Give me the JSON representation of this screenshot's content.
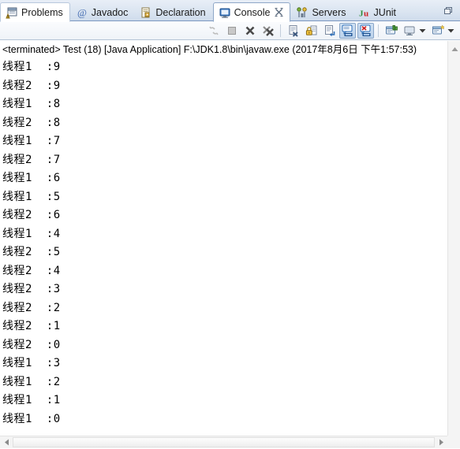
{
  "window": {
    "title": "Eclipse Console View"
  },
  "tabs": [
    {
      "label": "Problems",
      "icon": "problems-icon",
      "active": false,
      "closeable": false
    },
    {
      "label": "Javadoc",
      "icon": "javadoc-icon",
      "active": false,
      "closeable": false
    },
    {
      "label": "Declaration",
      "icon": "declaration-icon",
      "active": false,
      "closeable": false
    },
    {
      "label": "Console",
      "icon": "console-icon",
      "active": true,
      "closeable": true
    },
    {
      "label": "Servers",
      "icon": "servers-icon",
      "active": false,
      "closeable": false
    },
    {
      "label": "JUnit",
      "icon": "junit-icon",
      "active": false,
      "closeable": false
    }
  ],
  "tabbar": {
    "view_menu_label": "view-menu"
  },
  "toolbar": {
    "buttons": [
      {
        "name": "relaunch-button",
        "tooltip": "Relaunch",
        "state": "disabled"
      },
      {
        "name": "terminate-button",
        "tooltip": "Terminate",
        "state": "disabled"
      },
      {
        "name": "remove-launch-button",
        "tooltip": "Remove Launch",
        "state": "enabled"
      },
      {
        "name": "remove-all-terminated-button",
        "tooltip": "Remove All Terminated Launches",
        "state": "enabled"
      },
      {
        "name": "clear-console-button",
        "tooltip": "Clear Console",
        "state": "enabled"
      },
      {
        "name": "scroll-lock-button",
        "tooltip": "Scroll Lock",
        "state": "enabled"
      },
      {
        "name": "word-wrap-button",
        "tooltip": "Word Wrap",
        "state": "enabled"
      },
      {
        "name": "show-console-on-output-button",
        "tooltip": "Show Console When Standard Out Changes",
        "state": "pressed"
      },
      {
        "name": "show-console-on-error-button",
        "tooltip": "Show Console When Standard Error Changes",
        "state": "pressed"
      },
      {
        "name": "pin-console-button",
        "tooltip": "Pin Console",
        "state": "enabled"
      },
      {
        "name": "display-selected-console-button",
        "tooltip": "Display Selected Console",
        "state": "enabled"
      },
      {
        "name": "open-console-button",
        "tooltip": "Open Console",
        "state": "enabled"
      }
    ]
  },
  "console": {
    "header": "<terminated> Test (18) [Java Application] F:\\JDK1.8\\bin\\javaw.exe (2017年8月6日 下午1:57:53)",
    "lines": [
      "线程1  :9",
      "线程2  :9",
      "线程1  :8",
      "线程2  :8",
      "线程1  :7",
      "线程2  :7",
      "线程1  :6",
      "线程1  :5",
      "线程2  :6",
      "线程1  :4",
      "线程2  :5",
      "线程2  :4",
      "线程2  :3",
      "线程2  :2",
      "线程2  :1",
      "线程2  :0",
      "线程1  :3",
      "线程1  :2",
      "线程1  :1",
      "线程1  :0"
    ]
  },
  "scrollbars": {
    "vertical": {
      "name": "vertical-scrollbar"
    },
    "horizontal": {
      "name": "horizontal-scrollbar"
    }
  },
  "colors": {
    "tabbar_bg": "#dbe5f1",
    "active_tab_bg": "#ffffff",
    "console_bg": "#ffffff",
    "text": "#000000",
    "toolbar_pressed": "#bcd3ec"
  }
}
